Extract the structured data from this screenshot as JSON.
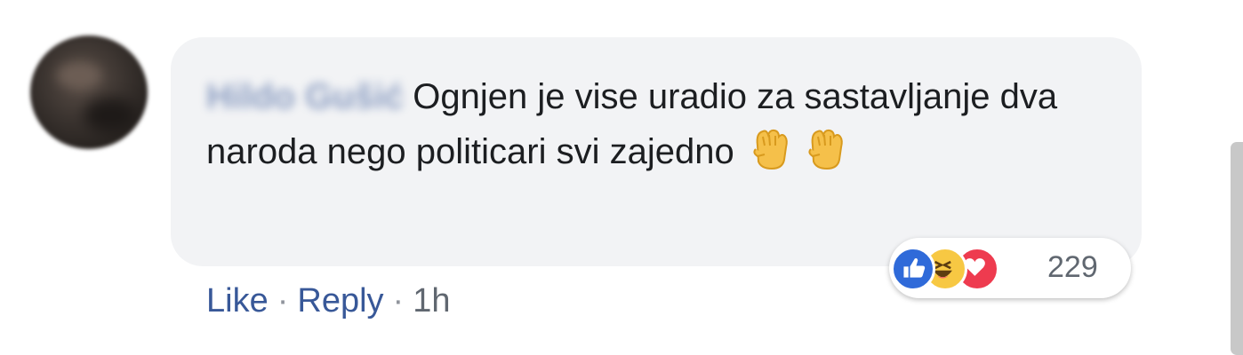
{
  "comment": {
    "author": "Hildo Gušić",
    "text": "Ognjen je vise uradio za sastavljanje dva naroda nego politicari svi zajedno",
    "emoji": [
      "raised-fist-icon",
      "raised-fist-icon"
    ]
  },
  "reactions": {
    "icons": [
      "like-icon",
      "haha-icon",
      "love-icon"
    ],
    "count": "229"
  },
  "actions": {
    "like_label": "Like",
    "separator": "·",
    "reply_label": "Reply",
    "timestamp": "1h"
  },
  "colors": {
    "bubble": "#f2f3f5",
    "link": "#385898",
    "like": "#2f6ad9",
    "haha": "#f7c843",
    "love": "#ee3b4f"
  }
}
